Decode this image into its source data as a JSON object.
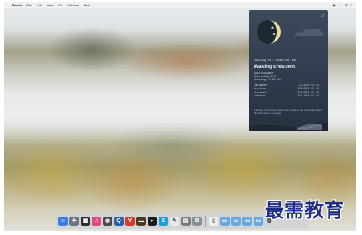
{
  "menubar": {
    "apple_icon": "apple-icon",
    "app_name": "Finder",
    "items": [
      "File",
      "Edit",
      "View",
      "Go",
      "Window",
      "Help"
    ],
    "status": [
      "◉",
      "☁",
      "⚲",
      "≡"
    ]
  },
  "widget": {
    "date": "Monday 11.1.2016 16 : 55",
    "phase": "Waxing crescent",
    "lines": [
      "Moon in Aquarius",
      "Moon visibility:   21%",
      "Moon's age:   1d 16h 23m"
    ],
    "table": [
      {
        "label": "Last quarter",
        "value": "1.1.2016 · 06 : 30"
      },
      {
        "label": "New moon",
        "value": "10.1.2016 · 02 : 30"
      },
      {
        "label": "First quarter",
        "value": "17.1.2016 · 00 : 26"
      },
      {
        "label": "Full moon",
        "value": "24.1.2016 · 02 : 46"
      }
    ],
    "note": "A full day on the Moon, from one sunrise to the next, takes about 29 Earth days on average."
  },
  "dock": {
    "apps": [
      {
        "name": "finder",
        "glyph": "☺",
        "color": "#3a7be0"
      },
      {
        "name": "launchpad",
        "glyph": "✈",
        "color": "#6a7684"
      },
      {
        "name": "mission-control",
        "glyph": "▦",
        "color": "#2d2d2d"
      },
      {
        "name": "itunes",
        "glyph": "♫",
        "color": "#e24a86"
      },
      {
        "name": "photos",
        "glyph": "◍",
        "color": "#4b4b4b"
      },
      {
        "name": "quicktime",
        "glyph": "Q",
        "color": "#2b5fa8"
      },
      {
        "name": "yandex-browser",
        "glyph": "Y",
        "color": "#d23a2a"
      },
      {
        "name": "sequel",
        "glyph": "▬",
        "color": "#4a3b22"
      },
      {
        "name": "terminal",
        "glyph": "▸",
        "color": "#1c1c1c"
      },
      {
        "name": "skype",
        "glyph": "S",
        "color": "#1a9ed8"
      },
      {
        "name": "textedit",
        "glyph": "✎",
        "color": "#e8e8e8"
      },
      {
        "name": "preview",
        "glyph": "▤",
        "color": "#7c7c7c"
      },
      {
        "name": "system-preferences",
        "glyph": "⚙",
        "color": "#8a8f95"
      }
    ],
    "right": [
      {
        "name": "document",
        "glyph": "▯",
        "color": "#f2f2f2"
      },
      {
        "name": "folder-1",
        "glyph": "▭",
        "color": "#6aa9e0"
      },
      {
        "name": "folder-2",
        "glyph": "▭",
        "color": "#6aa9e0"
      },
      {
        "name": "folder-3",
        "glyph": "▭",
        "color": "#6aa9e0"
      },
      {
        "name": "folder-4",
        "glyph": "▭",
        "color": "#6aa9e0"
      },
      {
        "name": "trash",
        "glyph": "🗑",
        "color": "#cfd3d7"
      }
    ]
  },
  "watermark": "最需教育"
}
